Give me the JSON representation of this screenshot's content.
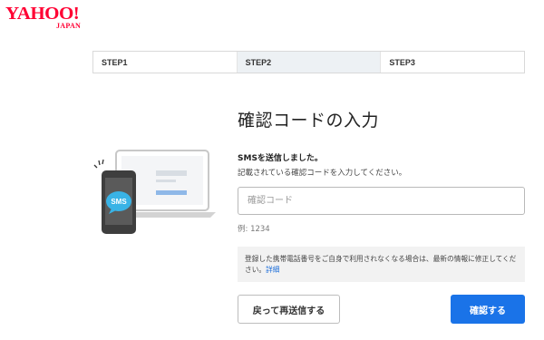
{
  "brand": {
    "logo_text": "YAHOO!",
    "logo_sub": "JAPAN",
    "color": "#ff0033"
  },
  "steps": [
    {
      "label": "STEP1",
      "active": false
    },
    {
      "label": "STEP2",
      "active": true
    },
    {
      "label": "STEP3",
      "active": false
    }
  ],
  "main": {
    "title": "確認コードの入力",
    "message_bold": "SMSを送信しました。",
    "message_sub": "記載されている確認コードを入力してください。",
    "code_input": {
      "placeholder": "確認コード",
      "value": ""
    },
    "example": "例: 1234",
    "notice_text": "登録した携帯電話番号をご自身で利用されなくなる場合は、最新の情報に修正してください。",
    "notice_link": "詳細"
  },
  "illustration": {
    "sms_label": "SMS",
    "icon": "phone-laptop-sms-icon"
  },
  "buttons": {
    "back_label": "戻って再送信する",
    "confirm_label": "確認する"
  },
  "colors": {
    "accent": "#1a73e8",
    "active_step_bg": "#edf1f4",
    "sms_bubble": "#39b3e6"
  }
}
